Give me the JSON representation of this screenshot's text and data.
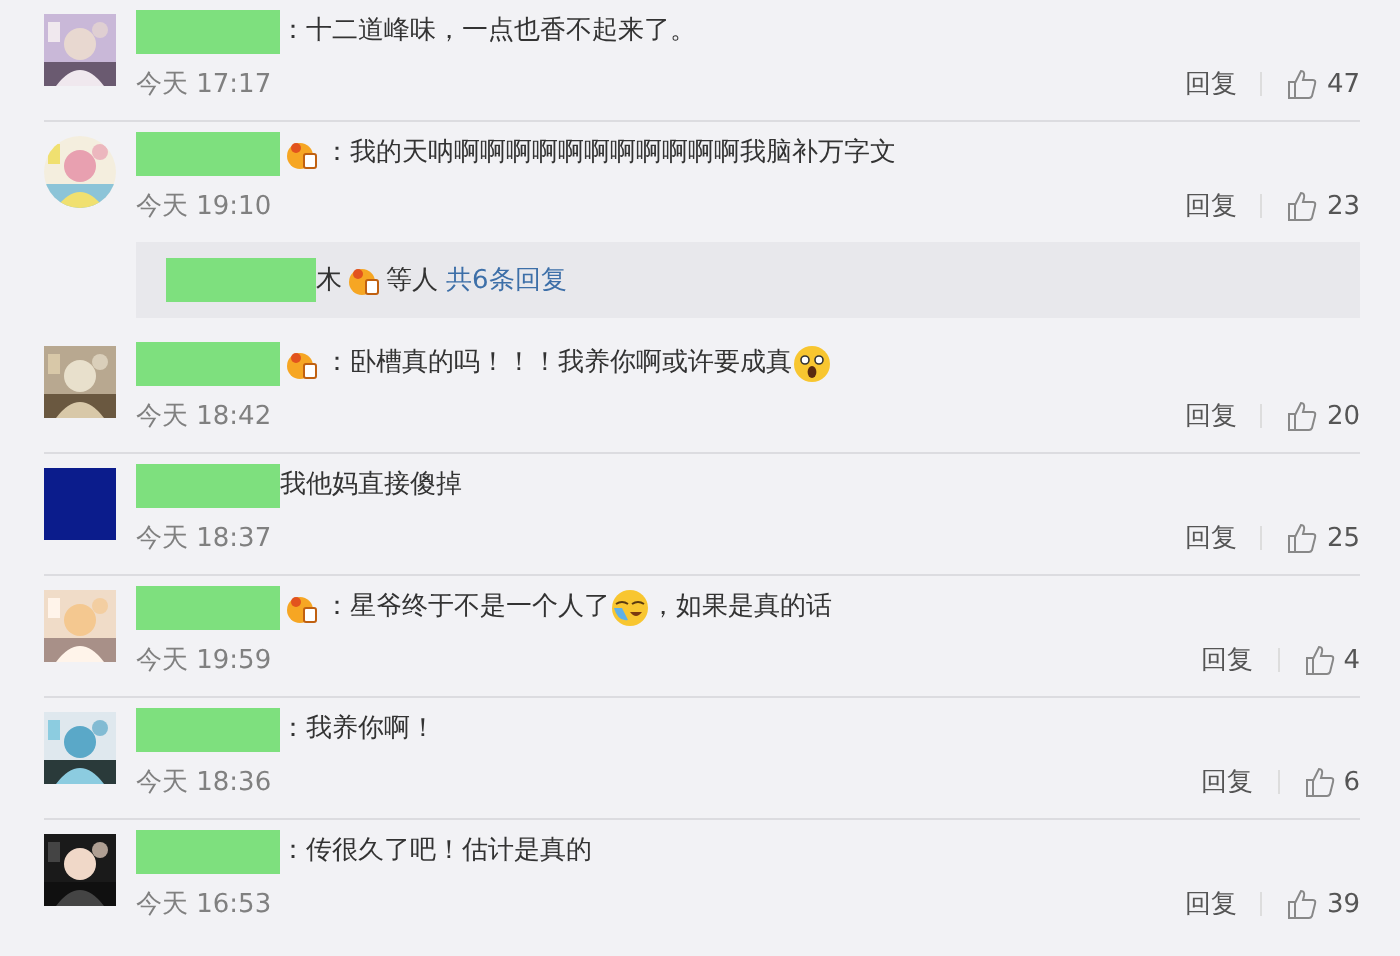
{
  "comments": [
    {
      "avatar": {
        "kind": "picture",
        "round": false
      },
      "badge": false,
      "parts": [
        {
          "kind": "text",
          "text": "：十二道峰味，一点也香不起来了。"
        }
      ],
      "time": "今天 17:17",
      "reply_label": "回复",
      "likes": "47"
    },
    {
      "avatar": {
        "kind": "picture",
        "round": true
      },
      "badge": true,
      "parts": [
        {
          "kind": "text",
          "text": "：我的天呐啊啊啊啊啊啊啊啊啊啊啊我脑补万字文"
        }
      ],
      "time": "今天 19:10",
      "reply_label": "回复",
      "likes": "23",
      "replies": {
        "name_tail": "木",
        "badge": true,
        "suffix": "等人",
        "link": "共6条回复"
      }
    },
    {
      "avatar": {
        "kind": "picture",
        "round": false
      },
      "badge": true,
      "parts": [
        {
          "kind": "text",
          "text": "：卧槽真的吗！！！我养你啊或许要成真"
        },
        {
          "kind": "scream"
        }
      ],
      "time": "今天 18:42",
      "reply_label": "回复",
      "likes": "20"
    },
    {
      "avatar": {
        "kind": "solid",
        "round": false,
        "color": "#0b1c8c"
      },
      "badge": false,
      "parts": [
        {
          "kind": "text",
          "text": "我他妈直接傻掉"
        }
      ],
      "time": "今天 18:37",
      "reply_label": "回复",
      "likes": "25"
    },
    {
      "avatar": {
        "kind": "picture",
        "round": false
      },
      "badge": true,
      "parts": [
        {
          "kind": "text",
          "text": "：星爷终于不是一个人了"
        },
        {
          "kind": "tears"
        },
        {
          "kind": "text",
          "text": "，如果是真的话"
        }
      ],
      "time": "今天 19:59",
      "reply_label": "回复",
      "likes": "4"
    },
    {
      "avatar": {
        "kind": "picture",
        "round": false
      },
      "badge": false,
      "parts": [
        {
          "kind": "text",
          "text": "：我养你啊！"
        }
      ],
      "time": "今天 18:36",
      "reply_label": "回复",
      "likes": "6"
    },
    {
      "avatar": {
        "kind": "picture",
        "round": false
      },
      "badge": false,
      "parts": [
        {
          "kind": "text",
          "text": "：传很久了吧！估计是真的"
        }
      ],
      "time": "今天 16:53",
      "reply_label": "回复",
      "likes": "39"
    }
  ]
}
